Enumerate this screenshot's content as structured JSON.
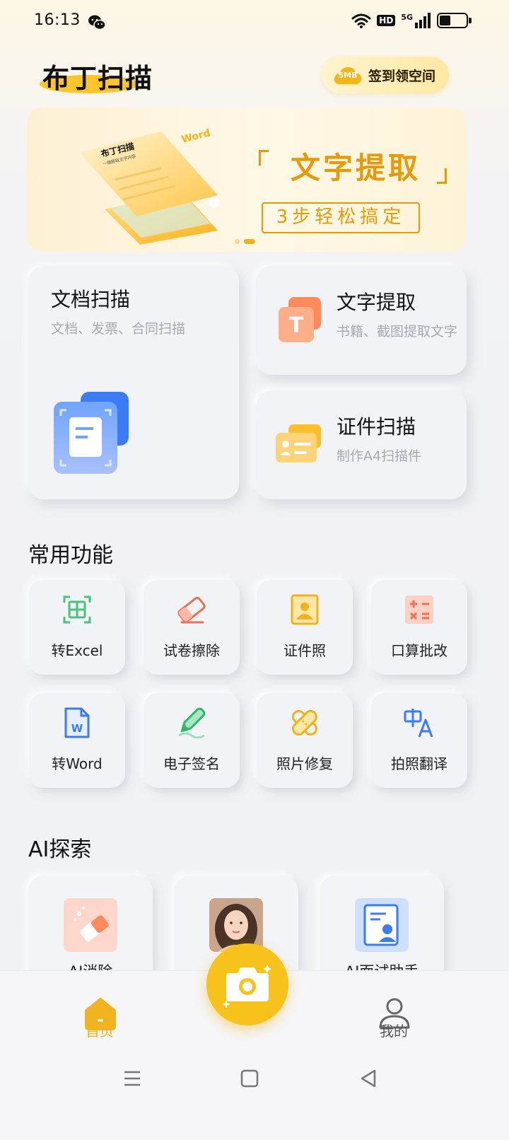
{
  "status_bar": {
    "time": "16:13",
    "hd": "HD",
    "network": "5G"
  },
  "header": {
    "brand": "布丁扫描",
    "signin": {
      "cloud_text": "5MB",
      "label": "签到领空间"
    }
  },
  "banner": {
    "art_label": "布丁扫描",
    "art_sub": "一键提取文字内容",
    "art_word": "Word",
    "title": "文字提取",
    "subtitle": "3步轻松搞定"
  },
  "main_cards": {
    "doc_scan": {
      "title": "文档扫描",
      "subtitle": "文档、发票、合同扫描"
    },
    "text_extract": {
      "title": "文字提取",
      "subtitle": "书籍、截图提取文字"
    },
    "id_scan": {
      "title": "证件扫描",
      "subtitle": "制作A4扫描件"
    }
  },
  "common": {
    "title": "常用功能",
    "items": [
      {
        "label": "转Excel",
        "icon": "excel-icon"
      },
      {
        "label": "试卷擦除",
        "icon": "eraser-icon"
      },
      {
        "label": "证件照",
        "icon": "id-photo-icon"
      },
      {
        "label": "口算批改",
        "icon": "calculator-icon"
      },
      {
        "label": "转Word",
        "icon": "word-icon"
      },
      {
        "label": "电子签名",
        "icon": "signature-pen-icon"
      },
      {
        "label": "照片修复",
        "icon": "bandage-icon"
      },
      {
        "label": "拍照翻译",
        "icon": "translate-icon"
      }
    ]
  },
  "ai": {
    "title": "AI探索",
    "items": [
      {
        "label": "AI消除",
        "icon": "ai-eraser-icon"
      },
      {
        "label": "",
        "icon": "portrait-photo"
      },
      {
        "label": "AI面试助手",
        "icon": "interview-icon"
      }
    ]
  },
  "tabbar": {
    "home": "首页",
    "me": "我的"
  },
  "colors": {
    "accent": "#f7c21c",
    "brand_orange": "#e79a06",
    "home_active": "#f0b21e"
  }
}
